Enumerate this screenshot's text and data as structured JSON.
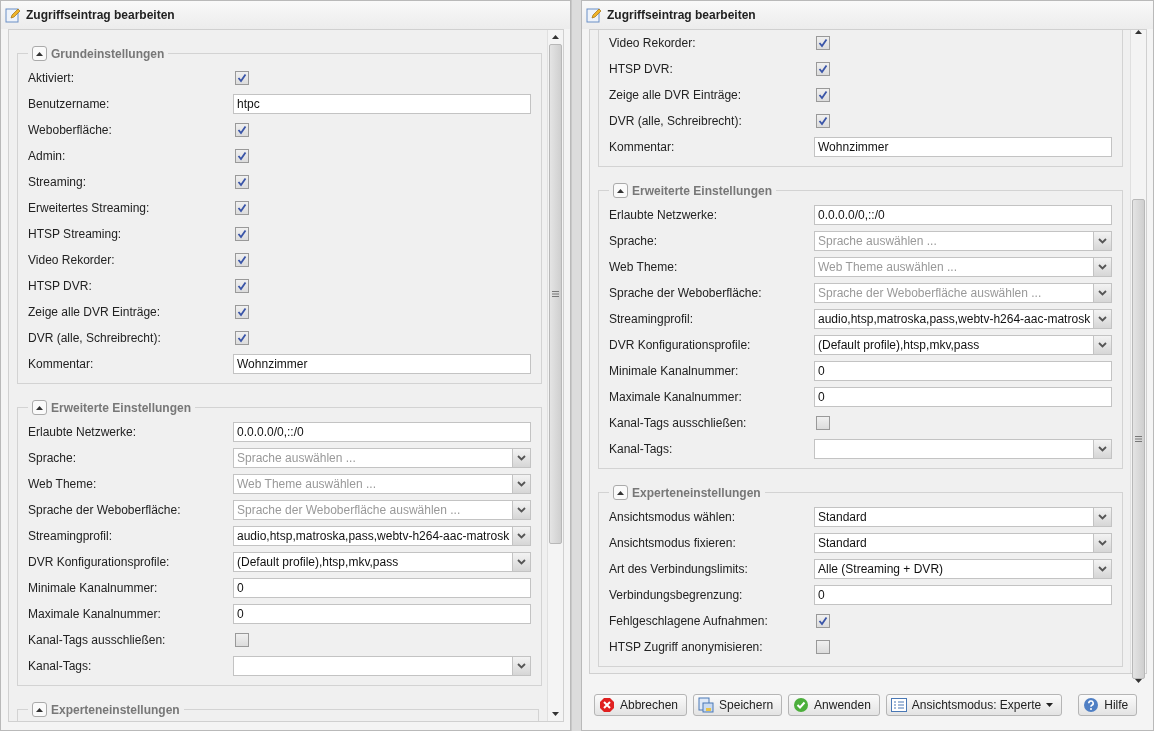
{
  "dialogs": [
    {
      "title": "Zugriffseintrag bearbeiten",
      "sections": [
        {
          "title": "Grundeinstellungen",
          "rows": [
            {
              "label": "Aktiviert:",
              "kind": "checkbox",
              "checked": true
            },
            {
              "label": "Benutzername:",
              "kind": "text",
              "value": "htpc"
            },
            {
              "label": "Weboberfläche:",
              "kind": "checkbox",
              "checked": true
            },
            {
              "label": "Admin:",
              "kind": "checkbox",
              "checked": true
            },
            {
              "label": "Streaming:",
              "kind": "checkbox",
              "checked": true
            },
            {
              "label": "Erweitertes Streaming:",
              "kind": "checkbox",
              "checked": true
            },
            {
              "label": "HTSP Streaming:",
              "kind": "checkbox",
              "checked": true
            },
            {
              "label": "Video Rekorder:",
              "kind": "checkbox",
              "checked": true
            },
            {
              "label": "HTSP DVR:",
              "kind": "checkbox",
              "checked": true
            },
            {
              "label": "Zeige alle DVR Einträge:",
              "kind": "checkbox",
              "checked": true
            },
            {
              "label": "DVR (alle, Schreibrecht):",
              "kind": "checkbox",
              "checked": true
            },
            {
              "label": "Kommentar:",
              "kind": "text",
              "value": "Wohnzimmer"
            }
          ]
        },
        {
          "title": "Erweiterte Einstellungen",
          "rows": [
            {
              "label": "Erlaubte Netzwerke:",
              "kind": "text",
              "value": "0.0.0.0/0,::/0"
            },
            {
              "label": "Sprache:",
              "kind": "select",
              "placeholder": "Sprache auswählen ..."
            },
            {
              "label": "Web Theme:",
              "kind": "select",
              "placeholder": "Web Theme auswählen ..."
            },
            {
              "label": "Sprache der Weboberfläche:",
              "kind": "select",
              "placeholder": "Sprache der Weboberfläche auswählen ..."
            },
            {
              "label": "Streamingprofil:",
              "kind": "select",
              "value": "audio,htsp,matroska,pass,webtv-h264-aac-matrosk"
            },
            {
              "label": "DVR Konfigurationsprofile:",
              "kind": "select",
              "value": "(Default profile),htsp,mkv,pass"
            },
            {
              "label": "Minimale Kanalnummer:",
              "kind": "text",
              "value": "0"
            },
            {
              "label": "Maximale Kanalnummer:",
              "kind": "text",
              "value": "0"
            },
            {
              "label": "Kanal-Tags ausschließen:",
              "kind": "checkbox",
              "checked": false
            },
            {
              "label": "Kanal-Tags:",
              "kind": "select"
            }
          ]
        },
        {
          "title": "Experteneinstellungen"
        }
      ]
    },
    {
      "title": "Zugriffseintrag bearbeiten",
      "sections": [
        {
          "rows": [
            {
              "label": "Video Rekorder:",
              "kind": "checkbox",
              "checked": true
            },
            {
              "label": "HTSP DVR:",
              "kind": "checkbox",
              "checked": true
            },
            {
              "label": "Zeige alle DVR Einträge:",
              "kind": "checkbox",
              "checked": true
            },
            {
              "label": "DVR (alle, Schreibrecht):",
              "kind": "checkbox",
              "checked": true
            },
            {
              "label": "Kommentar:",
              "kind": "text",
              "value": "Wohnzimmer"
            }
          ]
        },
        {
          "title": "Erweiterte Einstellungen",
          "rows": [
            {
              "label": "Erlaubte Netzwerke:",
              "kind": "text",
              "value": "0.0.0.0/0,::/0"
            },
            {
              "label": "Sprache:",
              "kind": "select",
              "placeholder": "Sprache auswählen ..."
            },
            {
              "label": "Web Theme:",
              "kind": "select",
              "placeholder": "Web Theme auswählen ..."
            },
            {
              "label": "Sprache der Weboberfläche:",
              "kind": "select",
              "placeholder": "Sprache der Weboberfläche auswählen ..."
            },
            {
              "label": "Streamingprofil:",
              "kind": "select",
              "value": "audio,htsp,matroska,pass,webtv-h264-aac-matrosk"
            },
            {
              "label": "DVR Konfigurationsprofile:",
              "kind": "select",
              "value": "(Default profile),htsp,mkv,pass"
            },
            {
              "label": "Minimale Kanalnummer:",
              "kind": "text",
              "value": "0"
            },
            {
              "label": "Maximale Kanalnummer:",
              "kind": "text",
              "value": "0"
            },
            {
              "label": "Kanal-Tags ausschließen:",
              "kind": "checkbox",
              "checked": false
            },
            {
              "label": "Kanal-Tags:",
              "kind": "select"
            }
          ]
        },
        {
          "title": "Experteneinstellungen",
          "rows": [
            {
              "label": "Ansichtsmodus wählen:",
              "kind": "select",
              "value": "Standard"
            },
            {
              "label": "Ansichtsmodus fixieren:",
              "kind": "select",
              "value": "Standard"
            },
            {
              "label": "Art des Verbindungslimits:",
              "kind": "select",
              "value": "Alle (Streaming + DVR)"
            },
            {
              "label": "Verbindungsbegrenzung:",
              "kind": "text",
              "value": "0"
            },
            {
              "label": "Fehlgeschlagene Aufnahmen:",
              "kind": "checkbox",
              "checked": true
            },
            {
              "label": "HTSP Zugriff anonymisieren:",
              "kind": "checkbox",
              "checked": false
            }
          ]
        }
      ],
      "buttons": [
        {
          "label": "Abbrechen",
          "kind": "cancel"
        },
        {
          "label": "Speichern",
          "kind": "save"
        },
        {
          "label": "Anwenden",
          "kind": "apply"
        },
        {
          "label": "Ansichtsmodus: Experte",
          "kind": "menu"
        },
        {
          "label": "Hilfe",
          "kind": "help"
        }
      ]
    }
  ]
}
